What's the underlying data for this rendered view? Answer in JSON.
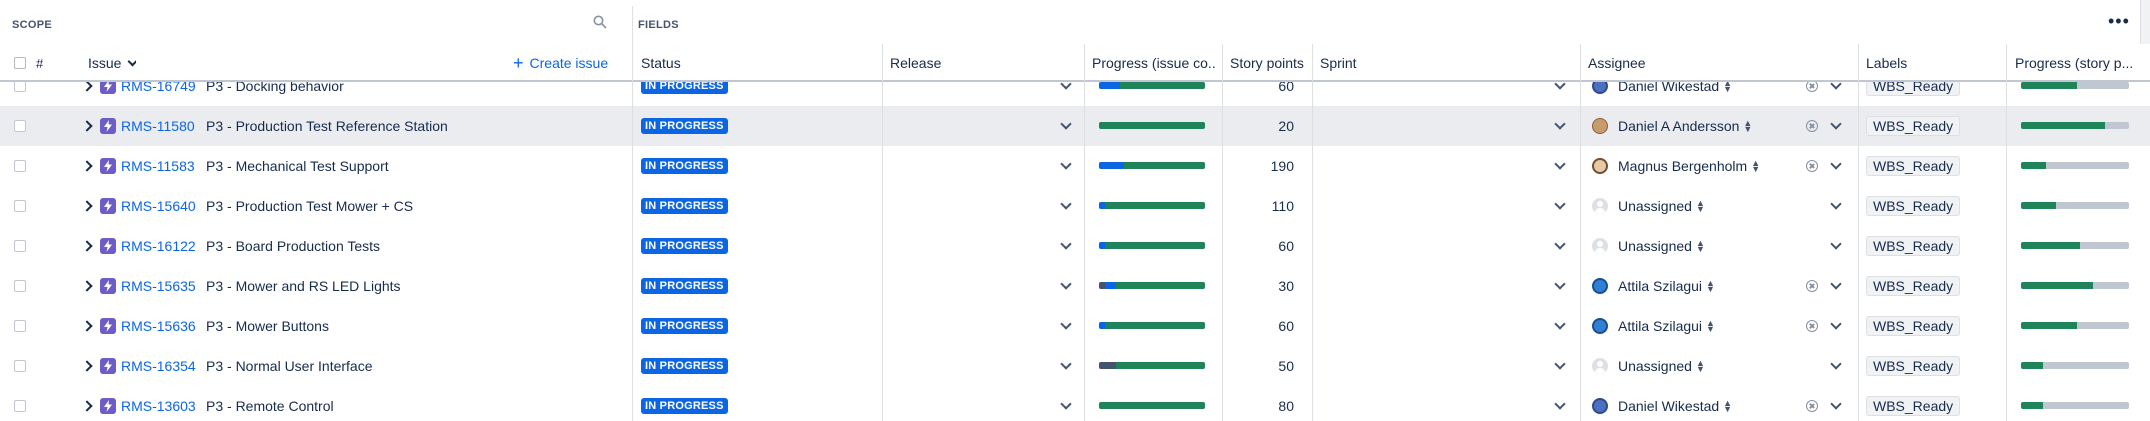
{
  "scope_label": "SCOPE",
  "fields_label": "FIELDS",
  "columns": {
    "hash": "#",
    "issue": "Issue",
    "create_issue": "Create issue",
    "status": "Status",
    "release": "Release",
    "progress_issue": "Progress (issue co...",
    "story_points": "Story points",
    "sprint": "Sprint",
    "assignee": "Assignee",
    "labels": "Labels",
    "progress_story": "Progress (story p..."
  },
  "rows": [
    {
      "key": "RMS-16749",
      "summary": "P3 - Docking behavior",
      "status": "IN PROGRESS",
      "points": "60",
      "assignee": "Daniel Wikestad",
      "avatar": "mono",
      "label": "WBS_Ready",
      "issue_progress": [
        0,
        0.2,
        0.8
      ],
      "story_progress": [
        0.52,
        0.48
      ]
    },
    {
      "key": "RMS-11580",
      "summary": "P3 - Production Test Reference Station",
      "status": "IN PROGRESS",
      "points": "20",
      "assignee": "Daniel A Andersson",
      "avatar": "brown",
      "label": "WBS_Ready",
      "issue_progress": [
        0,
        0,
        1.0
      ],
      "story_progress": [
        0.78,
        0.22
      ]
    },
    {
      "key": "RMS-11583",
      "summary": "P3 - Mechanical Test Support",
      "status": "IN PROGRESS",
      "points": "190",
      "assignee": "Magnus Bergenholm",
      "avatar": "beard",
      "label": "WBS_Ready",
      "issue_progress": [
        0,
        0.24,
        0.76
      ],
      "story_progress": [
        0.23,
        0.77
      ]
    },
    {
      "key": "RMS-15640",
      "summary": "P3 - Production Test Mower + CS",
      "status": "IN PROGRESS",
      "points": "110",
      "assignee": "Unassigned",
      "avatar": "none",
      "label": "WBS_Ready",
      "issue_progress": [
        0,
        0.06,
        0.94
      ],
      "story_progress": [
        0.32,
        0.68
      ]
    },
    {
      "key": "RMS-16122",
      "summary": "P3 - Board Production Tests",
      "status": "IN PROGRESS",
      "points": "60",
      "assignee": "Unassigned",
      "avatar": "none",
      "label": "WBS_Ready",
      "issue_progress": [
        0,
        0.06,
        0.94
      ],
      "story_progress": [
        0.55,
        0.45
      ]
    },
    {
      "key": "RMS-15635",
      "summary": "P3 - Mower and RS LED Lights",
      "status": "IN PROGRESS",
      "points": "30",
      "assignee": "Attila Szilagui",
      "avatar": "blue",
      "label": "WBS_Ready",
      "issue_progress": [
        0.06,
        0.1,
        0.84
      ],
      "story_progress": [
        0.67,
        0.33
      ]
    },
    {
      "key": "RMS-15636",
      "summary": "P3 - Mower Buttons",
      "status": "IN PROGRESS",
      "points": "60",
      "assignee": "Attila Szilagui",
      "avatar": "blue",
      "label": "WBS_Ready",
      "issue_progress": [
        0,
        0.06,
        0.94
      ],
      "story_progress": [
        0.52,
        0.48
      ]
    },
    {
      "key": "RMS-16354",
      "summary": "P3 - Normal User Interface",
      "status": "IN PROGRESS",
      "points": "50",
      "assignee": "Unassigned",
      "avatar": "none",
      "label": "WBS_Ready",
      "issue_progress": [
        0.16,
        0,
        0.84
      ],
      "story_progress": [
        0.2,
        0.8
      ]
    },
    {
      "key": "RMS-13603",
      "summary": "P3 - Remote Control",
      "status": "IN PROGRESS",
      "points": "80",
      "assignee": "Daniel Wikestad",
      "avatar": "mono",
      "label": "WBS_Ready",
      "issue_progress": [
        0,
        0,
        1.0
      ],
      "story_progress": [
        0.2,
        0.8
      ]
    }
  ],
  "selected_row": 1,
  "colors": {
    "accent": "#0c66e4",
    "status_bg": "#0c66e4",
    "done_green": "#1f845a",
    "todo_gray": "#c1c7d0",
    "epic_purple": "#6e5dc6"
  }
}
